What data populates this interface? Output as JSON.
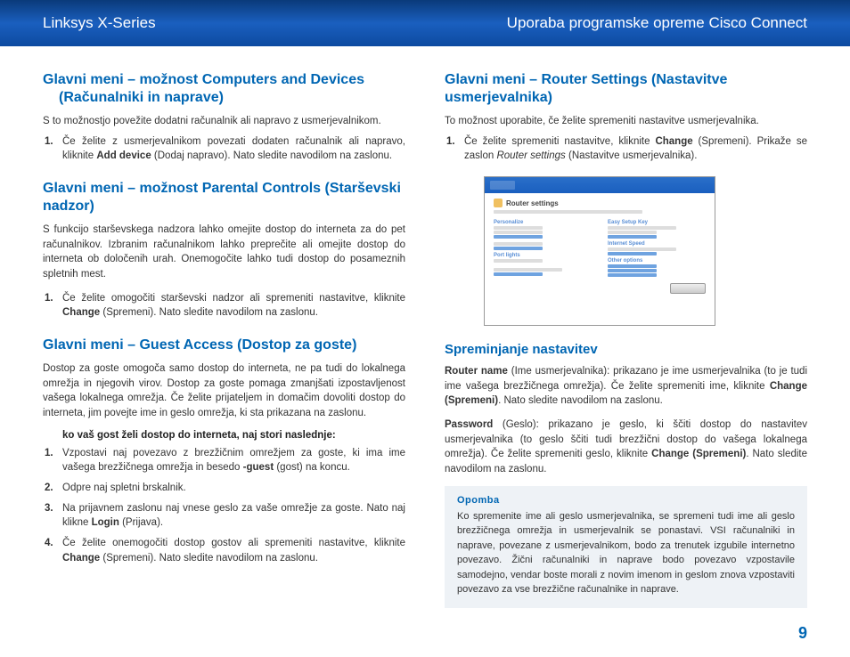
{
  "header": {
    "left": "Linksys X-Series",
    "right": "Uporaba programske opreme Cisco Connect"
  },
  "left": {
    "s1": {
      "title_l1": "Glavni meni – možnost Computers and Devices",
      "title_l2": "(Računalniki in naprave)",
      "intro": "S to možnostjo povežite dodatni računalnik ali napravo z usmerjevalnikom.",
      "li1_a": "Če želite z usmerjevalnikom povezati dodaten računalnik ali napravo, kliknite ",
      "li1_b": "Add device",
      "li1_c": " (Dodaj napravo). Nato sledite navodilom na zaslonu."
    },
    "s2": {
      "title": "Glavni meni – možnost Parental Controls (Starševski nadzor)",
      "intro": "S funkcijo starševskega nadzora lahko omejite dostop do interneta za do pet računalnikov. Izbranim računalnikom lahko preprečite ali omejite dostop do interneta ob določenih urah. Onemogočite lahko tudi dostop do posameznih spletnih mest.",
      "li1_a": "Če želite omogočiti starševski nadzor ali spremeniti nastavitve, kliknite ",
      "li1_b": "Change",
      "li1_c": " (Spremeni). Nato sledite navodilom na zaslonu."
    },
    "s3": {
      "title": "Glavni meni – Guest Access (Dostop za goste)",
      "intro": "Dostop za goste omogoča samo dostop do interneta, ne pa tudi do lokalnega omrežja in njegovih virov. Dostop za goste pomaga zmanjšati izpostavljenost vašega lokalnega omrežja. Če želite prijateljem in domačim dovoliti dostop do interneta, jim povejte ime in geslo omrežja, ki sta prikazana na zaslonu.",
      "sub": "ko vaš gost želi dostop do interneta, naj stori naslednje:",
      "li1_a": "Vzpostavi naj povezavo z brezžičnim omrežjem za goste, ki ima ime vašega brezžičnega omrežja in besedo ",
      "li1_b": "-guest",
      "li1_c": " (gost) na koncu.",
      "li2": "Odpre naj spletni brskalnik.",
      "li3_a": "Na prijavnem zaslonu naj vnese geslo za vaše omrežje za goste. Nato naj klikne ",
      "li3_b": "Login",
      "li3_c": " (Prijava).",
      "li4_a": "Če želite onemogočiti dostop gostov ali spremeniti nastavitve, kliknite ",
      "li4_b": "Change",
      "li4_c": " (Spremeni). Nato sledite navodilom na zaslonu."
    }
  },
  "right": {
    "s1": {
      "title": "Glavni meni – Router Settings (Nastavitve usmerjevalnika)",
      "intro": "To možnost uporabite, če želite spremeniti nastavitve usmerjevalnika.",
      "li1_a": "Če želite spremeniti nastavitve, kliknite ",
      "li1_b": "Change",
      "li1_c": " (Spremeni). Prikaže se zaslon ",
      "li1_d": "Router settings",
      "li1_e": " (Nastavitve usmerjevalnika)."
    },
    "mock": {
      "title": "Router settings",
      "h1": "Personalize",
      "h2": "Easy Setup Key",
      "h3": "Port lights",
      "h4": "Internet Speed",
      "h5": "Other options"
    },
    "s2": {
      "title": "Spreminjanje nastavitev",
      "p1_a": "Router name",
      "p1_b": " (Ime usmerjevalnika): prikazano je ime usmerjevalnika (to je tudi ime vašega brezžičnega omrežja). Če želite spremeniti ime, kliknite ",
      "p1_c": "Change (Spremeni)",
      "p1_d": ". Nato sledite navodilom na zaslonu.",
      "p2_a": "Password",
      "p2_b": " (Geslo): prikazano je geslo, ki ščiti dostop do nastavitev usmerjevalnika (to geslo ščiti tudi brezžični dostop do vašega lokalnega omrežja). Če želite spremeniti geslo, kliknite ",
      "p2_c": "Change (Spremeni)",
      "p2_d": ". Nato sledite navodilom na zaslonu."
    },
    "note": {
      "label": "Opomba",
      "body": "Ko spremenite ime ali geslo usmerjevalnika, se spremeni tudi ime ali geslo brezžičnega omrežja in usmerjevalnik se ponastavi. VSI računalniki in naprave, povezane z usmerjevalnikom, bodo za trenutek izgubile internetno povezavo. Žični računalniki in naprave bodo povezavo vzpostavile samodejno, vendar boste morali z novim imenom in geslom znova vzpostaviti povezavo za vse brezžične računalnike in naprave."
    }
  },
  "page_number": "9"
}
